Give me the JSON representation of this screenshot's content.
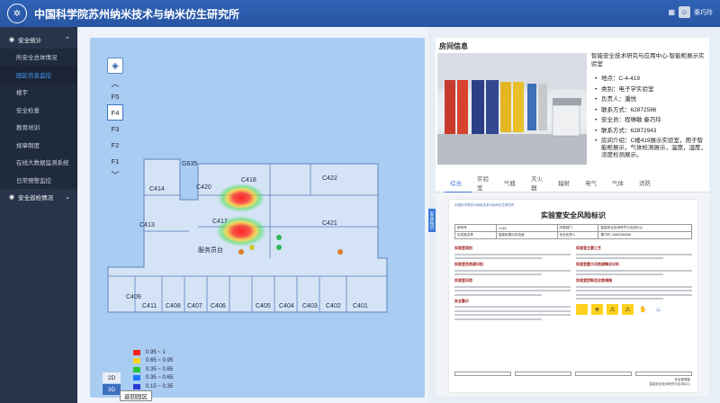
{
  "header": {
    "logo_glyph": "✲",
    "title": "中国科学院苏州纳米技术与纳米仿生研究所",
    "user_name": "秦巧玲",
    "user_icon": "user-avatar",
    "menu_icon": "grid-icon"
  },
  "sidebar": {
    "groups": [
      {
        "label": "安全统计",
        "icon": "dot-icon",
        "expanded": true,
        "items": [
          {
            "label": "所安全总体情况"
          },
          {
            "label": "园区信息监控",
            "active": true
          },
          {
            "label": "楼宇"
          },
          {
            "label": "安全检查"
          },
          {
            "label": "教育培训"
          },
          {
            "label": "规章制度"
          },
          {
            "label": "在线大数据监测系统"
          },
          {
            "label": "日常预警监控"
          }
        ]
      },
      {
        "label": "安全巡检情况",
        "icon": "dot-icon",
        "expanded": false
      }
    ]
  },
  "map": {
    "floors": [
      "F5",
      "F4",
      "F3",
      "F2",
      "F1"
    ],
    "active_floor": "F4",
    "rooms": [
      "G635",
      "C418",
      "C422",
      "C414",
      "C420",
      "C413",
      "C417",
      "C421",
      "C409",
      "C411",
      "C408",
      "C407",
      "C406",
      "C405",
      "C404",
      "C403",
      "C402",
      "C401"
    ],
    "corridor_label": "服务员台",
    "legend": [
      {
        "label": "0.95 ~ 1",
        "color": "#ff2020"
      },
      {
        "label": "0.65 ~ 0.95",
        "color": "#ffd21e"
      },
      {
        "label": "0.35 ~ 0.65",
        "color": "#22c63a"
      },
      {
        "label": "0.35 ~ 0.65",
        "color": "#1f76ff"
      },
      {
        "label": "0.15 ~ 0.35",
        "color": "#2a3bd6"
      }
    ],
    "view_2d": "2D",
    "view_3d": "3D",
    "active_view": "3D",
    "back_label": "返回园区"
  },
  "room_info": {
    "section_title": "房间信息",
    "room_title": "智能安全技术研究与应用中心-智能柜展示实验室",
    "props": [
      "地点：C-4-419",
      "类别：电子学实验室",
      "负责人：潘悦",
      "联系方式：62872586",
      "安全员：程琳敏 秦巧玲",
      "联系方式：62872943",
      "房间介绍：C楼419展示实验室，用于智能柜展示，气体检测展示，温度，湿度，浓度检测展示。"
    ]
  },
  "tabs": {
    "items": [
      "综合",
      "实验室",
      "气瓶",
      "灭火器",
      "辐射",
      "电气",
      "气体",
      "消防"
    ],
    "active": "综合",
    "side_tag": "安全标识"
  },
  "document": {
    "top_line": "中国科学院苏州纳米技术与纳米仿生研究所",
    "heading": "实验室安全风险标识",
    "table": [
      [
        "房间号",
        "C418",
        "所属部门",
        "智能安全技术研究与应用中心"
      ],
      [
        "实验室名称",
        "智能柜展示实验室",
        "安全负责人",
        "秦巧玲 13862085986"
      ]
    ],
    "left_sections": [
      "实验室类别",
      "实验室危险源识别",
      "实验室风险"
    ],
    "right_sections": [
      "实验室主要工艺",
      "实验室重大风险源情况分析",
      "实验室控制及应急措施"
    ],
    "warning_section": "安全警示",
    "hazard_icons": [
      "⚡",
      "☣",
      "⚠",
      "⚠",
      "✋",
      "♨"
    ],
    "sign_line1": "安全管理部",
    "sign_line2": "智能安全技术研究与应用中心"
  }
}
